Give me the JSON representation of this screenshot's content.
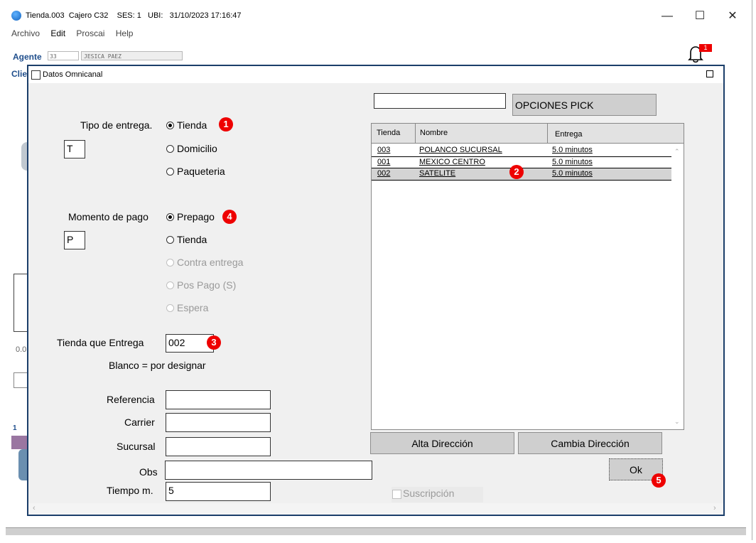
{
  "window": {
    "title": "Tienda.003  Cajero C32    SES: 1   UBI:   31/10/2023 17:16:47",
    "minimize": "—",
    "maximize": "☐",
    "close": "✕"
  },
  "menu": [
    "Archivo",
    "Edit",
    "Proscai",
    "Help"
  ],
  "header": {
    "agent_label": "Agente",
    "agent_code": "33",
    "agent_name": "JESICA PAEZ",
    "client_label": "Clie",
    "notification_count": "1"
  },
  "background": {
    "value_00": "0.0",
    "list_number": "1"
  },
  "dialog": {
    "title": "Datos Omnicanal",
    "tipo_entrega": {
      "label": "Tipo de entrega.",
      "code": "T",
      "options": [
        "Tienda",
        "Domicilio",
        "Paqueteria"
      ],
      "selected": "Tienda"
    },
    "momento_pago": {
      "label": "Momento de pago",
      "code": "P",
      "options": [
        "Prepago",
        "Tienda",
        "Contra entrega",
        "Pos Pago  (S)",
        "Espera"
      ],
      "selected": "Prepago",
      "disabled": [
        "Contra entrega",
        "Pos Pago  (S)",
        "Espera"
      ]
    },
    "tienda_entrega": {
      "label": "Tienda que Entrega",
      "value": "002",
      "hint": "Blanco = por designar"
    },
    "fields": {
      "referencia_label": "Referencia",
      "referencia_value": "",
      "carrier_label": "Carrier",
      "carrier_value": "",
      "sucursal_label": "Sucursal",
      "sucursal_value": "",
      "obs_label": "Obs",
      "obs_value": "",
      "tiempo_label": "Tiempo m.",
      "tiempo_value": "5"
    },
    "pick_search_value": "",
    "pick_button": "OPCIONES PICK",
    "table": {
      "headers": [
        "Tienda",
        "Nombre",
        "Entrega"
      ],
      "rows": [
        [
          "003",
          "POLANCO SUCURSAL",
          "5.0 minutos"
        ],
        [
          "001",
          "MEXICO CENTRO",
          "5.0 minutos"
        ],
        [
          "002",
          "SATELITE",
          "5.0 minutos"
        ]
      ]
    },
    "alta_button": "Alta Dirección",
    "cambia_button": "Cambia Dirección",
    "ok_button": "Ok",
    "suscripcion_label": "Suscripción"
  },
  "callouts": [
    "1",
    "2",
    "3",
    "4",
    "5"
  ],
  "colors": {
    "badge": "#e00000",
    "dialog_border": "#1b3e6a",
    "agent_label": "#1f4e8c"
  }
}
